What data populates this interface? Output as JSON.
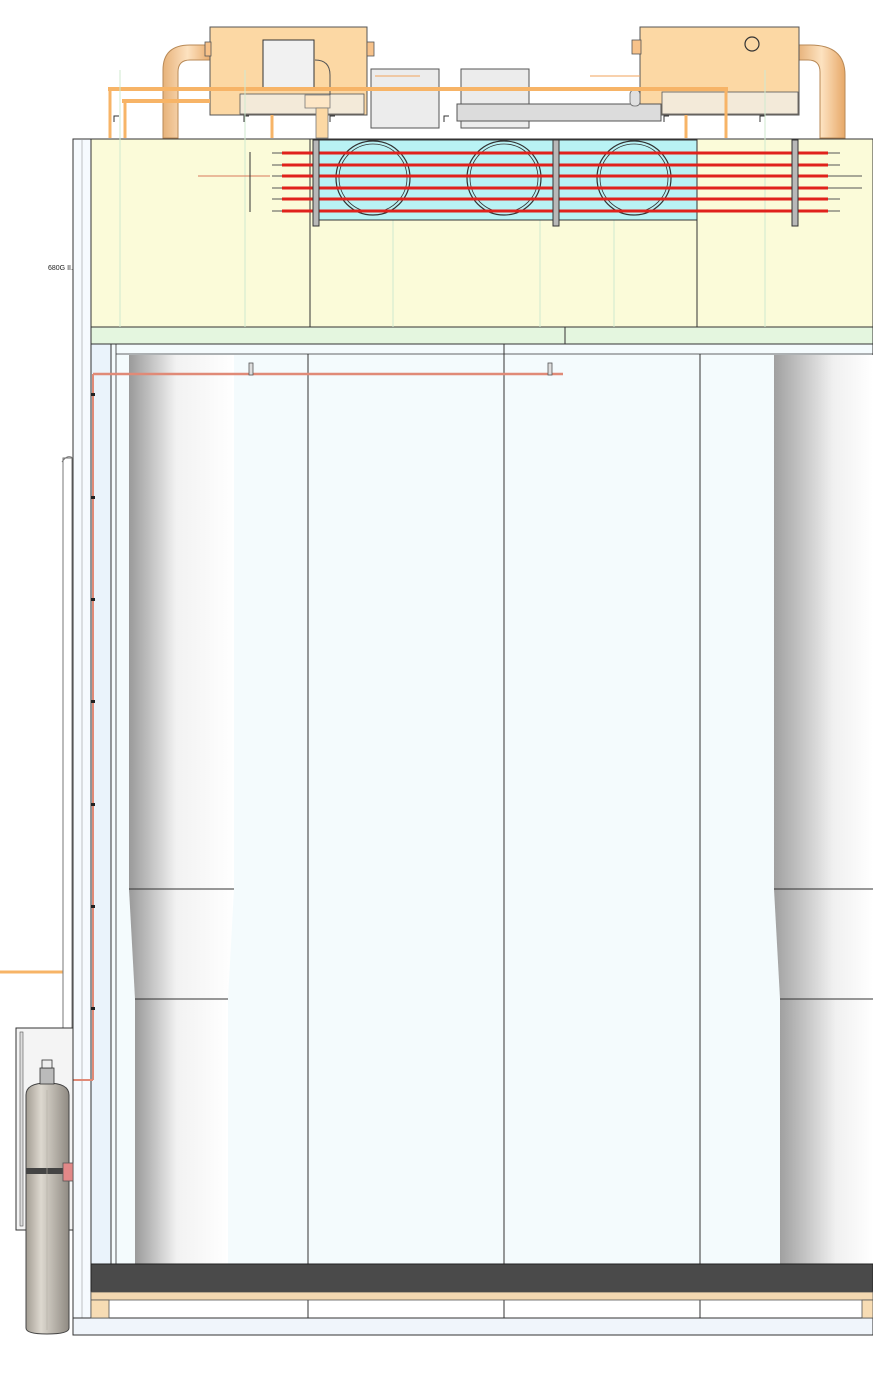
{
  "drawing": {
    "label": "680G II."
  },
  "colors": {
    "unit_fill": "#fcd8a4",
    "pipe_orange": "#f7b467",
    "panel_yellow": "#fbfbd9",
    "coil_cyan": "#b9f2f4",
    "refrigerant_red": "#e0211c",
    "chamber_fill": "#f4fbfd",
    "floor_dark": "#4a4a4a",
    "cylinder_gray": "#c9c3b9"
  },
  "components": [
    {
      "id": "left-condensing-unit",
      "icon": "box"
    },
    {
      "id": "right-condensing-unit",
      "icon": "box"
    },
    {
      "id": "evaporator-coil",
      "icon": "fan-coil"
    },
    {
      "id": "gas-cylinder",
      "icon": "cylinder"
    },
    {
      "id": "columns",
      "icon": "column"
    }
  ]
}
